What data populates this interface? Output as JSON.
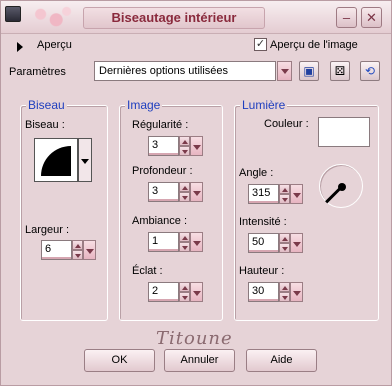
{
  "window": {
    "title": "Biseautage intérieur",
    "minimize_label": "–",
    "close_label": "✕"
  },
  "preview": {
    "label": "Aperçu",
    "image_preview_label": "Aperçu de l'image",
    "image_preview_checked": true
  },
  "presets": {
    "label": "Paramètres",
    "value": "Dernières options utilisées"
  },
  "bevel_group": {
    "title": "Biseau",
    "shape_label": "Biseau :",
    "width_label": "Largeur :",
    "width_value": "6"
  },
  "image_group": {
    "title": "Image",
    "smoothness_label": "Régularité :",
    "smoothness_value": "3",
    "depth_label": "Profondeur :",
    "depth_value": "3",
    "ambience_label": "Ambiance :",
    "ambience_value": "1",
    "shininess_label": "Éclat :",
    "shininess_value": "2"
  },
  "light_group": {
    "title": "Lumière",
    "color_label": "Couleur :",
    "color_value": "#ffffff",
    "angle_label": "Angle :",
    "angle_value": "315",
    "intensity_label": "Intensité :",
    "intensity_value": "50",
    "elevation_label": "Hauteur :",
    "elevation_value": "30"
  },
  "watermark": "Titoune",
  "buttons": {
    "ok": "OK",
    "cancel": "Annuler",
    "help": "Aide"
  },
  "icons": {
    "save": "save-icon",
    "randomize": "dice-icon",
    "reset": "reset-icon"
  }
}
